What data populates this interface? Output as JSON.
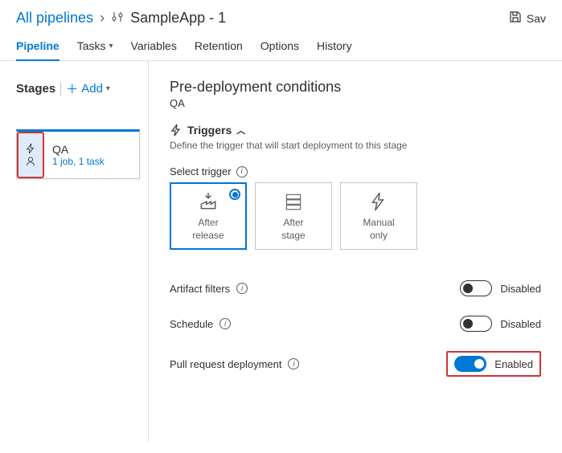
{
  "breadcrumb": {
    "root": "All pipelines",
    "current": "SampleApp - 1"
  },
  "header": {
    "save_label": "Sav"
  },
  "tabs": [
    {
      "label": "Pipeline",
      "active": true
    },
    {
      "label": "Tasks",
      "dropdown": true
    },
    {
      "label": "Variables"
    },
    {
      "label": "Retention"
    },
    {
      "label": "Options"
    },
    {
      "label": "History"
    }
  ],
  "sidebar": {
    "stages_label": "Stages",
    "add_label": "Add",
    "stage": {
      "name": "QA",
      "subtitle": "1 job, 1 task"
    }
  },
  "panel": {
    "title": "Pre-deployment conditions",
    "stage_name": "QA",
    "triggers": {
      "header": "Triggers",
      "description": "Define the trigger that will start deployment to this stage",
      "select_label": "Select trigger",
      "options": [
        {
          "line1": "After",
          "line2": "release",
          "selected": true
        },
        {
          "line1": "After",
          "line2": "stage"
        },
        {
          "line1": "Manual",
          "line2": "only"
        }
      ]
    },
    "rows": {
      "artifact_filters": {
        "label": "Artifact filters",
        "state": "Disabled",
        "enabled": false
      },
      "schedule": {
        "label": "Schedule",
        "state": "Disabled",
        "enabled": false
      },
      "pull_request": {
        "label": "Pull request deployment",
        "state": "Enabled",
        "enabled": true
      }
    }
  }
}
